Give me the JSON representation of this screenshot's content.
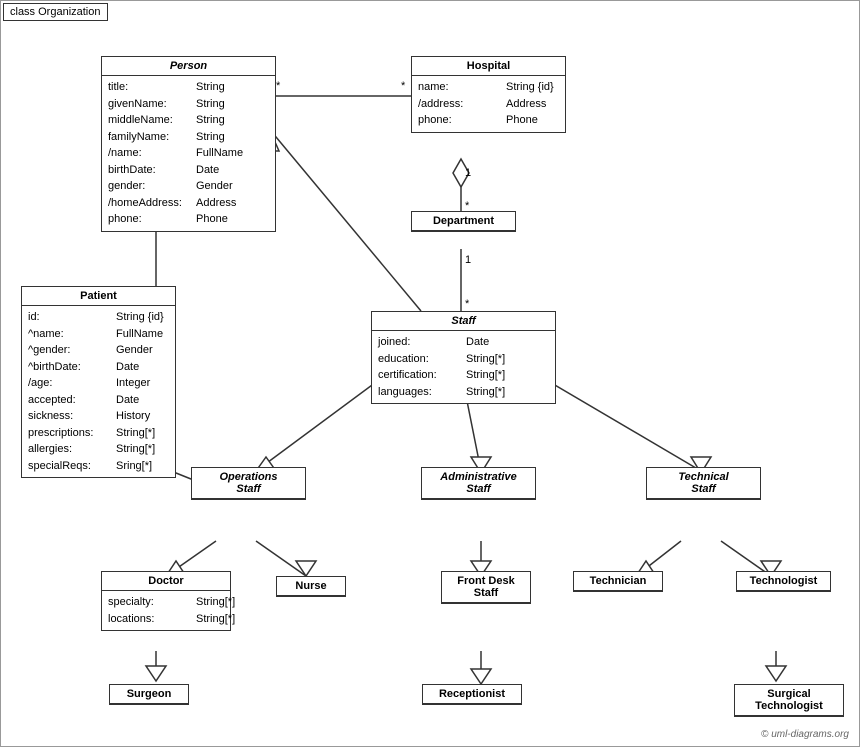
{
  "diagram": {
    "title": "class Organization",
    "watermark": "© uml-diagrams.org",
    "classes": {
      "person": {
        "name": "Person",
        "italic": true,
        "attrs": [
          {
            "name": "title:",
            "type": "String"
          },
          {
            "name": "givenName:",
            "type": "String"
          },
          {
            "name": "middleName:",
            "type": "String"
          },
          {
            "name": "familyName:",
            "type": "String"
          },
          {
            "name": "/name:",
            "type": "FullName"
          },
          {
            "name": "birthDate:",
            "type": "Date"
          },
          {
            "name": "gender:",
            "type": "Gender"
          },
          {
            "name": "/homeAddress:",
            "type": "Address"
          },
          {
            "name": "phone:",
            "type": "Phone"
          }
        ]
      },
      "hospital": {
        "name": "Hospital",
        "italic": false,
        "attrs": [
          {
            "name": "name:",
            "type": "String {id}"
          },
          {
            "name": "/address:",
            "type": "Address"
          },
          {
            "name": "phone:",
            "type": "Phone"
          }
        ]
      },
      "patient": {
        "name": "Patient",
        "italic": false,
        "attrs": [
          {
            "name": "id:",
            "type": "String {id}"
          },
          {
            "name": "^name:",
            "type": "FullName"
          },
          {
            "name": "^gender:",
            "type": "Gender"
          },
          {
            "name": "^birthDate:",
            "type": "Date"
          },
          {
            "name": "/age:",
            "type": "Integer"
          },
          {
            "name": "accepted:",
            "type": "Date"
          },
          {
            "name": "sickness:",
            "type": "History"
          },
          {
            "name": "prescriptions:",
            "type": "String[*]"
          },
          {
            "name": "allergies:",
            "type": "String[*]"
          },
          {
            "name": "specialReqs:",
            "type": "Sring[*]"
          }
        ]
      },
      "department": {
        "name": "Department",
        "italic": false,
        "attrs": []
      },
      "staff": {
        "name": "Staff",
        "italic": true,
        "attrs": [
          {
            "name": "joined:",
            "type": "Date"
          },
          {
            "name": "education:",
            "type": "String[*]"
          },
          {
            "name": "certification:",
            "type": "String[*]"
          },
          {
            "name": "languages:",
            "type": "String[*]"
          }
        ]
      },
      "operations_staff": {
        "name": "Operations Staff",
        "italic": true,
        "attrs": []
      },
      "administrative_staff": {
        "name": "Administrative Staff",
        "italic": true,
        "attrs": []
      },
      "technical_staff": {
        "name": "Technical Staff",
        "italic": true,
        "attrs": []
      },
      "doctor": {
        "name": "Doctor",
        "italic": false,
        "attrs": [
          {
            "name": "specialty:",
            "type": "String[*]"
          },
          {
            "name": "locations:",
            "type": "String[*]"
          }
        ]
      },
      "nurse": {
        "name": "Nurse",
        "italic": false,
        "attrs": []
      },
      "front_desk_staff": {
        "name": "Front Desk Staff",
        "italic": false,
        "attrs": []
      },
      "technician": {
        "name": "Technician",
        "italic": false,
        "attrs": []
      },
      "technologist": {
        "name": "Technologist",
        "italic": false,
        "attrs": []
      },
      "surgeon": {
        "name": "Surgeon",
        "italic": false,
        "attrs": []
      },
      "receptionist": {
        "name": "Receptionist",
        "italic": false,
        "attrs": []
      },
      "surgical_technologist": {
        "name": "Surgical Technologist",
        "italic": false,
        "attrs": []
      }
    }
  }
}
